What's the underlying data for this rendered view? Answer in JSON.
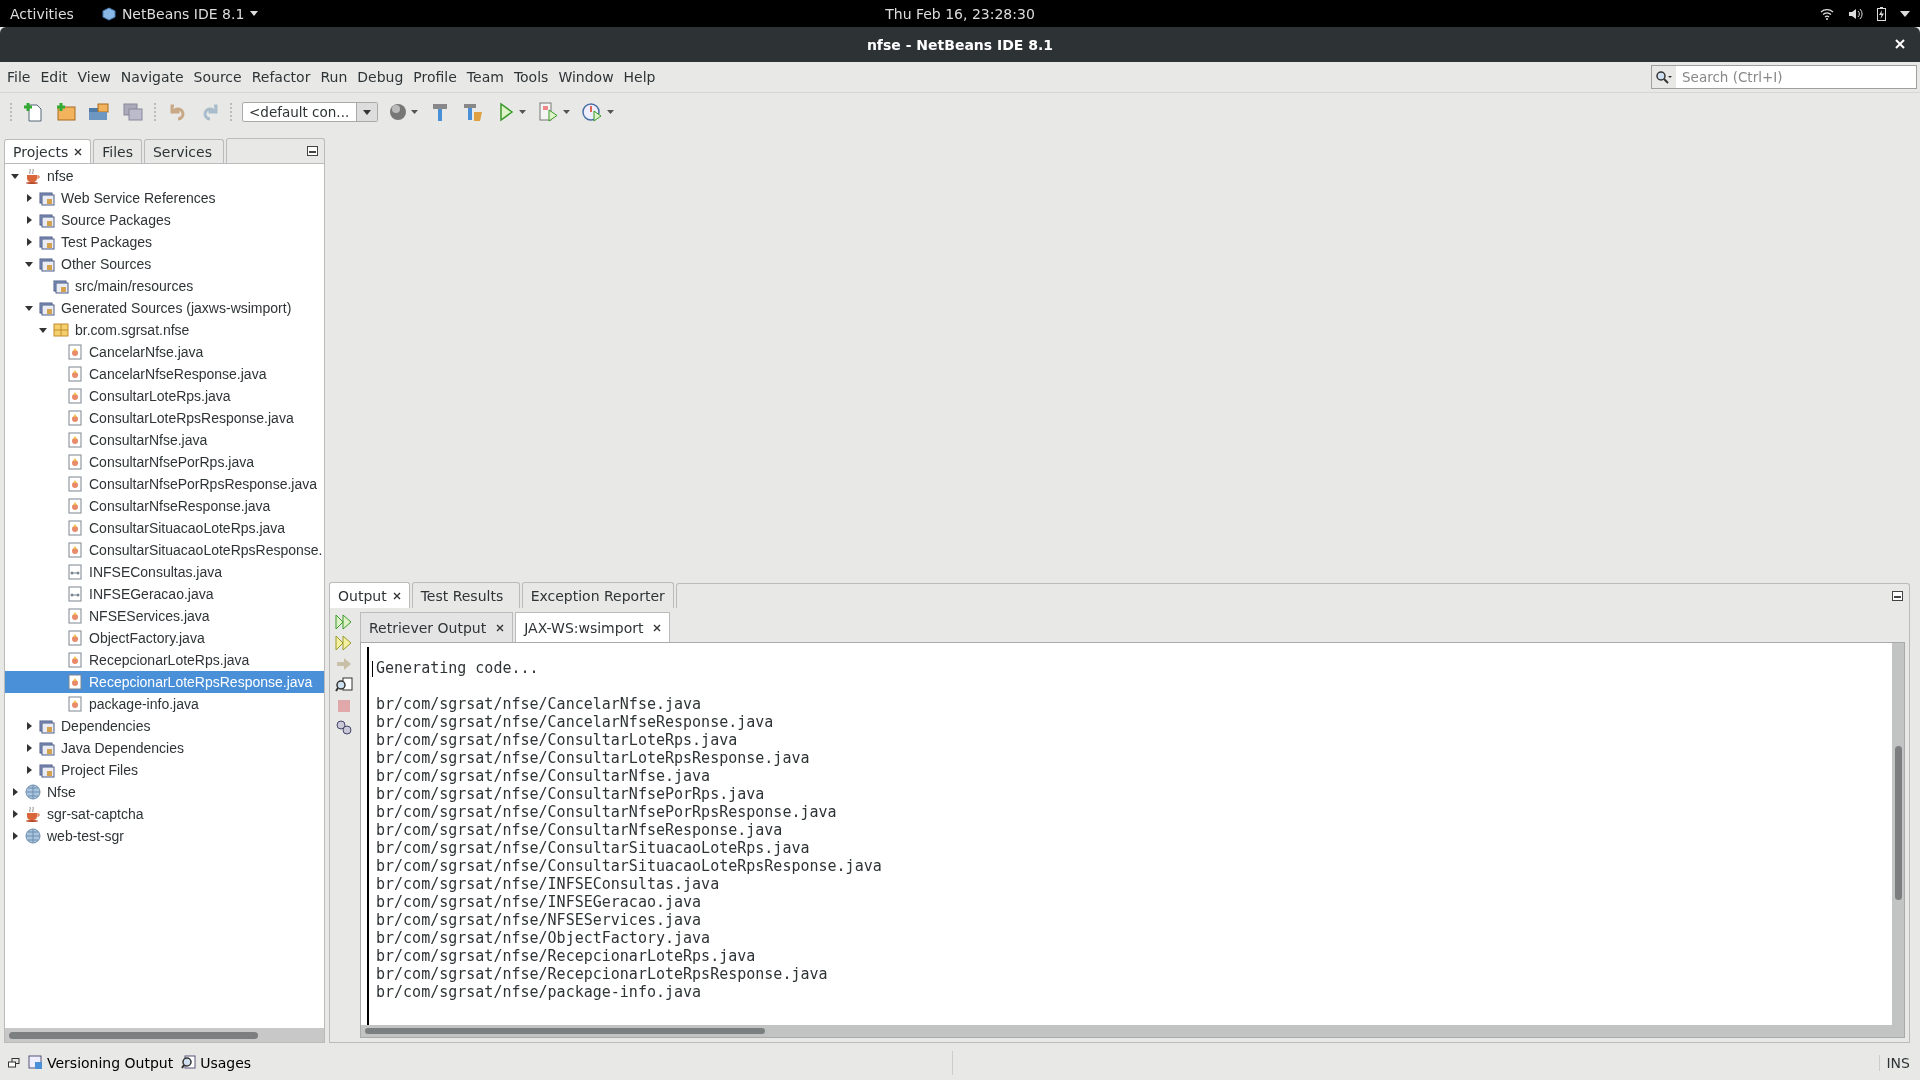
{
  "top_bar": {
    "activities": "Activities",
    "app_menu": "NetBeans IDE 8.1",
    "clock": "Thu Feb 16, 23:28:30"
  },
  "window": {
    "title": "nfse - NetBeans IDE 8.1"
  },
  "menu": [
    "File",
    "Edit",
    "View",
    "Navigate",
    "Source",
    "Refactor",
    "Run",
    "Debug",
    "Profile",
    "Team",
    "Tools",
    "Window",
    "Help"
  ],
  "search": {
    "placeholder": "Search (Ctrl+I)"
  },
  "toolbar": {
    "config": "<default con..."
  },
  "project_tabs": [
    {
      "label": "Projects",
      "selected": true,
      "closable": true
    },
    {
      "label": "Files",
      "selected": false,
      "closable": false
    },
    {
      "label": "Services",
      "selected": false,
      "closable": false
    }
  ],
  "tree": [
    {
      "label": "nfse",
      "kind": "project",
      "expanded": true,
      "selected": false,
      "children": [
        {
          "label": "Web Service References",
          "kind": "folder",
          "expanded": false,
          "selected": false
        },
        {
          "label": "Source Packages",
          "kind": "folder",
          "expanded": false,
          "selected": false
        },
        {
          "label": "Test Packages",
          "kind": "folder",
          "expanded": false,
          "selected": false
        },
        {
          "label": "Other Sources",
          "kind": "folder",
          "expanded": true,
          "selected": false,
          "children": [
            {
              "label": "src/main/resources",
              "kind": "folder",
              "selected": false
            }
          ]
        },
        {
          "label": "Generated Sources (jaxws-wsimport)",
          "kind": "folder",
          "expanded": true,
          "selected": false,
          "children": [
            {
              "label": "br.com.sgrsat.nfse",
              "kind": "package",
              "expanded": true,
              "selected": false,
              "children": [
                {
                  "label": "CancelarNfse.java",
                  "kind": "class",
                  "selected": false
                },
                {
                  "label": "CancelarNfseResponse.java",
                  "kind": "class",
                  "selected": false
                },
                {
                  "label": "ConsultarLoteRps.java",
                  "kind": "class",
                  "selected": false
                },
                {
                  "label": "ConsultarLoteRpsResponse.java",
                  "kind": "class",
                  "selected": false
                },
                {
                  "label": "ConsultarNfse.java",
                  "kind": "class",
                  "selected": false
                },
                {
                  "label": "ConsultarNfsePorRps.java",
                  "kind": "class",
                  "selected": false
                },
                {
                  "label": "ConsultarNfsePorRpsResponse.java",
                  "kind": "class",
                  "selected": false
                },
                {
                  "label": "ConsultarNfseResponse.java",
                  "kind": "class",
                  "selected": false
                },
                {
                  "label": "ConsultarSituacaoLoteRps.java",
                  "kind": "class",
                  "selected": false
                },
                {
                  "label": "ConsultarSituacaoLoteRpsResponse.",
                  "kind": "class",
                  "selected": false
                },
                {
                  "label": "INFSEConsultas.java",
                  "kind": "interface",
                  "selected": false
                },
                {
                  "label": "INFSEGeracao.java",
                  "kind": "interface",
                  "selected": false
                },
                {
                  "label": "NFSEServices.java",
                  "kind": "class",
                  "selected": false
                },
                {
                  "label": "ObjectFactory.java",
                  "kind": "class",
                  "selected": false
                },
                {
                  "label": "RecepcionarLoteRps.java",
                  "kind": "class",
                  "selected": false
                },
                {
                  "label": "RecepcionarLoteRpsResponse.java",
                  "kind": "class",
                  "selected": true
                },
                {
                  "label": "package-info.java",
                  "kind": "class",
                  "selected": false
                }
              ]
            }
          ]
        },
        {
          "label": "Dependencies",
          "kind": "folder",
          "expanded": false,
          "selected": false
        },
        {
          "label": "Java Dependencies",
          "kind": "folder",
          "expanded": false,
          "selected": false
        },
        {
          "label": "Project Files",
          "kind": "folder",
          "expanded": false,
          "selected": false
        }
      ]
    },
    {
      "label": "Nfse",
      "kind": "web-project",
      "expanded": false,
      "selected": false
    },
    {
      "label": "sgr-sat-captcha",
      "kind": "project",
      "expanded": false,
      "selected": false
    },
    {
      "label": "web-test-sgr",
      "kind": "web-project",
      "expanded": false,
      "selected": false
    }
  ],
  "output_tabs": [
    {
      "label": "Output",
      "selected": true,
      "closable": true
    },
    {
      "label": "Test Results",
      "selected": false,
      "closable": false
    },
    {
      "label": "Exception Reporter",
      "selected": false,
      "closable": false
    }
  ],
  "output_subtabs": [
    {
      "label": "Retriever Output",
      "selected": false
    },
    {
      "label": "JAX-WS:wsimport",
      "selected": true
    }
  ],
  "output": {
    "header": "Generating code...",
    "lines": [
      "br/com/sgrsat/nfse/CancelarNfse.java",
      "br/com/sgrsat/nfse/CancelarNfseResponse.java",
      "br/com/sgrsat/nfse/ConsultarLoteRps.java",
      "br/com/sgrsat/nfse/ConsultarLoteRpsResponse.java",
      "br/com/sgrsat/nfse/ConsultarNfse.java",
      "br/com/sgrsat/nfse/ConsultarNfsePorRps.java",
      "br/com/sgrsat/nfse/ConsultarNfsePorRpsResponse.java",
      "br/com/sgrsat/nfse/ConsultarNfseResponse.java",
      "br/com/sgrsat/nfse/ConsultarSituacaoLoteRps.java",
      "br/com/sgrsat/nfse/ConsultarSituacaoLoteRpsResponse.java",
      "br/com/sgrsat/nfse/INFSEConsultas.java",
      "br/com/sgrsat/nfse/INFSEGeracao.java",
      "br/com/sgrsat/nfse/NFSEServices.java",
      "br/com/sgrsat/nfse/ObjectFactory.java",
      "br/com/sgrsat/nfse/RecepcionarLoteRps.java",
      "br/com/sgrsat/nfse/RecepcionarLoteRpsResponse.java",
      "br/com/sgrsat/nfse/package-info.java"
    ]
  },
  "status_bar": {
    "items": [
      "Versioning Output",
      "Usages"
    ],
    "mode": "INS"
  }
}
